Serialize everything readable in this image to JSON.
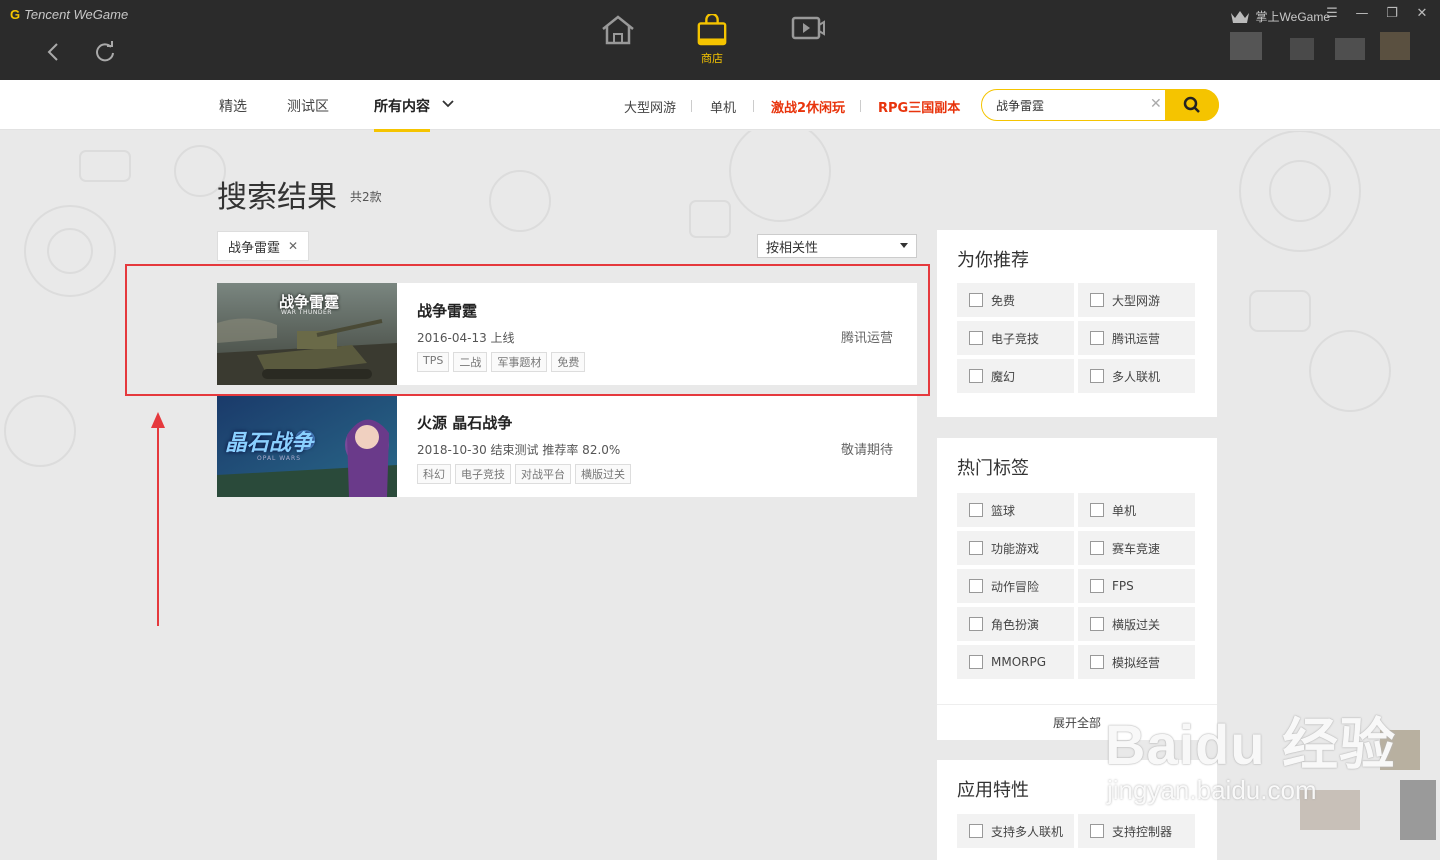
{
  "app": {
    "logo_text": "Tencent WeGame",
    "user_name": "掌上WeGame",
    "store_label": "商店"
  },
  "subnav": {
    "tabs": [
      "精选",
      "测试区",
      "所有内容"
    ],
    "quick_links": [
      "大型网游",
      "单机",
      "激战2休闲玩",
      "RPG三国副本"
    ]
  },
  "search": {
    "value": "战争雷霆"
  },
  "results": {
    "title": "搜索结果",
    "count": "共2款",
    "filter_chip": "战争雷霆",
    "sort": "按相关性",
    "games": [
      {
        "name": "战争雷霆",
        "date": "2016-04-13 上线",
        "tags": [
          "TPS",
          "二战",
          "军事题材",
          "免费"
        ],
        "publisher": "腾讯运营",
        "thumb_title": "战争雷霆",
        "thumb_subtitle": "WAR THUNDER"
      },
      {
        "name": "火源 晶石战争",
        "date": "2018-10-30 结束测试  推荐率  82.0%",
        "tags": [
          "科幻",
          "电子竞技",
          "对战平台",
          "横版过关"
        ],
        "publisher": "敬请期待",
        "thumb_title": "晶石战争",
        "thumb_subtitle": "OPAL WARS"
      }
    ]
  },
  "sidebar": {
    "recommend": {
      "title": "为你推荐",
      "items": [
        "免费",
        "大型网游",
        "电子竞技",
        "腾讯运营",
        "魔幻",
        "多人联机"
      ]
    },
    "hot_tags": {
      "title": "热门标签",
      "items": [
        "篮球",
        "单机",
        "功能游戏",
        "赛车竞速",
        "动作冒险",
        "FPS",
        "角色扮演",
        "横版过关",
        "MMORPG",
        "模拟经营"
      ],
      "expand_label": "展开全部"
    },
    "features": {
      "title": "应用特性",
      "items": [
        "支持多人联机",
        "支持控制器"
      ]
    }
  },
  "watermark": {
    "main": "Baidu 经验",
    "sub": "jingyan.baidu.com"
  },
  "colors": {
    "accent": "#f5c400",
    "hot_link": "#e8340c",
    "highlight": "#e5393d",
    "titlebar": "#2b2b2b"
  }
}
